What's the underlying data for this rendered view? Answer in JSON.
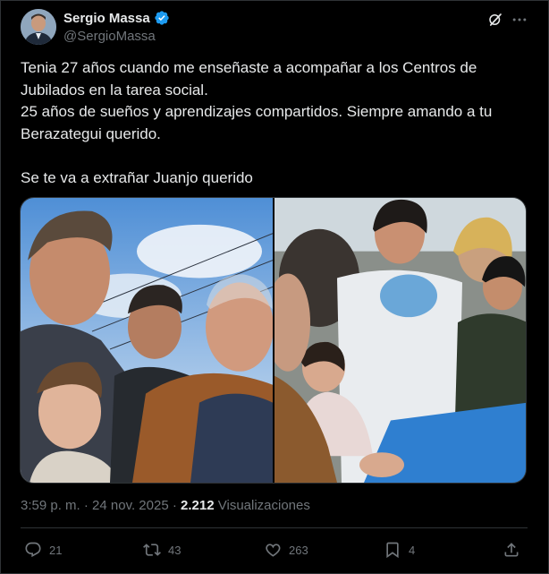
{
  "author": {
    "name": "Sergio Massa",
    "handle": "@SergioMassa",
    "verified_icon": "verified-badge-icon",
    "avatar_icon": "avatar-photo"
  },
  "header_icons": [
    "grok-icon",
    "more-icon"
  ],
  "tweet": {
    "text": "Tenia 27 años cuando me enseñaste a acompañar a los Centros de Jubilados en la tarea social.\n25 años de sueños y aprendizajes compartidos. Siempre amando a tu Berazategui querido.\n\nSe te va a extrañar Juanjo querido"
  },
  "meta": {
    "time": "3:59 p. m.",
    "separator": " · ",
    "date": "24 nov. 2025",
    "views_count": "2.212",
    "views_label": "Visualizaciones"
  },
  "actions": {
    "replies": "21",
    "reposts": "43",
    "likes": "263",
    "bookmarks": "4"
  },
  "colors": {
    "background": "#000000",
    "text": "#e7e9ea",
    "muted": "#71767b",
    "border": "#2f3336",
    "verified": "#1d9bf0"
  }
}
